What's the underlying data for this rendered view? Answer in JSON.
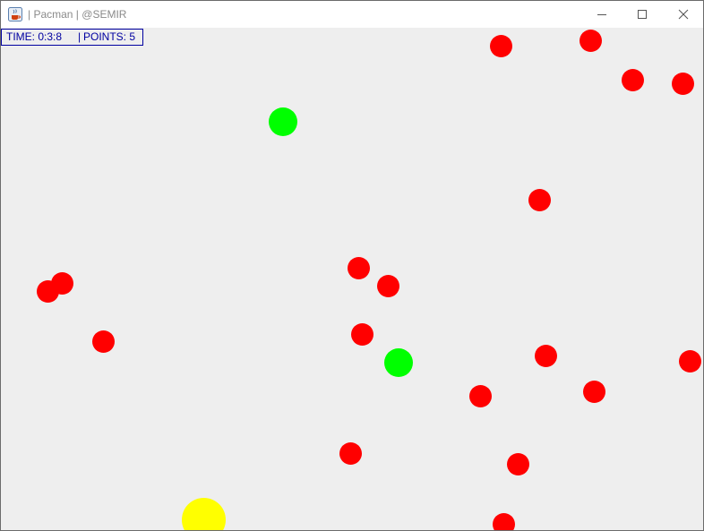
{
  "window": {
    "title": "| Pacman | @SEMIR",
    "icon": "java-cup-icon",
    "controls": [
      "minimize-icon",
      "maximize-icon",
      "close-icon"
    ]
  },
  "hud": {
    "time_label": "TIME: 0:3:8",
    "points_label": "POINTS: 5",
    "separator": "|"
  },
  "colors": {
    "background": "#eeeeee",
    "enemy": "#ff0000",
    "food": "#00ff00",
    "player": "#ffff00",
    "hud_text": "#0000a0"
  }
}
